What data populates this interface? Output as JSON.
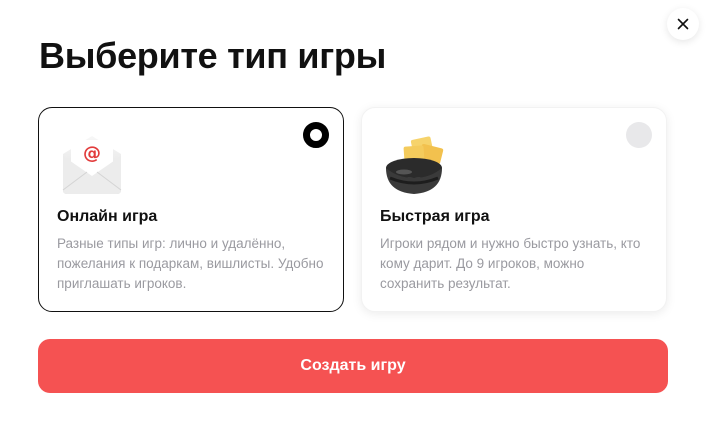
{
  "title": "Выберите тип игры",
  "close_icon": "close-icon",
  "cards": [
    {
      "title": "Онлайн игра",
      "description": "Разные типы игр: лично и удалённо, пожелания к подаркам, вишлисты. Удобно приглашать игроков.",
      "icon": "envelope-at-icon",
      "selected": true
    },
    {
      "title": "Быстрая игра",
      "description": "Игроки рядом и нужно быстро узнать, кто кому дарит. До 9 игроков, можно сохранить результат.",
      "icon": "hat-with-papers-icon",
      "selected": false
    }
  ],
  "create_button": "Создать игру",
  "colors": {
    "accent": "#f55252",
    "text": "#111111",
    "muted": "#9a9aa0",
    "radio_off": "#e8e8ea"
  }
}
